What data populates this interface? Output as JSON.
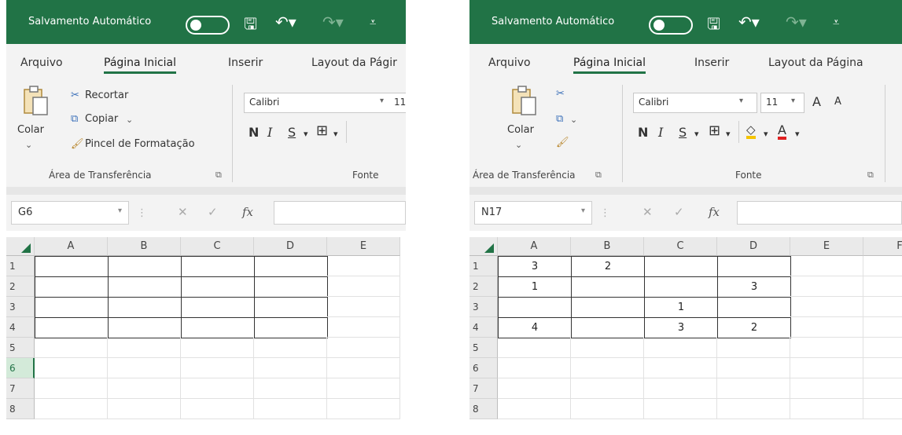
{
  "left": {
    "autosave_label": "Salvamento Automático",
    "tabs": [
      "Arquivo",
      "Página Inicial",
      "Inserir",
      "Layout da Págir"
    ],
    "clipboard": {
      "paste": "Colar",
      "cut": "Recortar",
      "copy": "Copiar",
      "format_painter": "Pincel de Formatação",
      "group": "Área de Transferência"
    },
    "font": {
      "name": "Calibri",
      "size": "11",
      "group": "Fonte",
      "bold": "N",
      "italic": "I",
      "underline": "S"
    },
    "name_box": "G6",
    "fx": "fx",
    "columns": [
      "A",
      "B",
      "C",
      "D",
      "E"
    ],
    "rows": [
      "1",
      "2",
      "3",
      "4",
      "5",
      "6",
      "7",
      "8"
    ],
    "cells": [
      [
        "",
        "",
        "",
        ""
      ],
      [
        "",
        "",
        "",
        ""
      ],
      [
        "",
        "",
        "",
        ""
      ],
      [
        "",
        "",
        "",
        ""
      ]
    ]
  },
  "right": {
    "autosave_label": "Salvamento Automático",
    "tabs": [
      "Arquivo",
      "Página Inicial",
      "Inserir",
      "Layout da Página"
    ],
    "clipboard": {
      "paste": "Colar",
      "group": "Área de Transferência"
    },
    "font": {
      "name": "Calibri",
      "size": "11",
      "group": "Fonte",
      "bold": "N",
      "italic": "I",
      "underline": "S",
      "grow": "A",
      "shrink": "A",
      "color_a": "A"
    },
    "name_box": "N17",
    "fx": "fx",
    "columns": [
      "A",
      "B",
      "C",
      "D",
      "E",
      "F"
    ],
    "rows": [
      "1",
      "2",
      "3",
      "4",
      "5",
      "6",
      "7",
      "8"
    ],
    "cells": [
      [
        "3",
        "2",
        "",
        ""
      ],
      [
        "1",
        "",
        "",
        "3"
      ],
      [
        "",
        "",
        "1",
        ""
      ],
      [
        "4",
        "",
        "3",
        "2"
      ]
    ]
  },
  "colors": {
    "excel_green": "#217346",
    "fill_yellow": "#f5c400",
    "font_red": "#e02020"
  }
}
